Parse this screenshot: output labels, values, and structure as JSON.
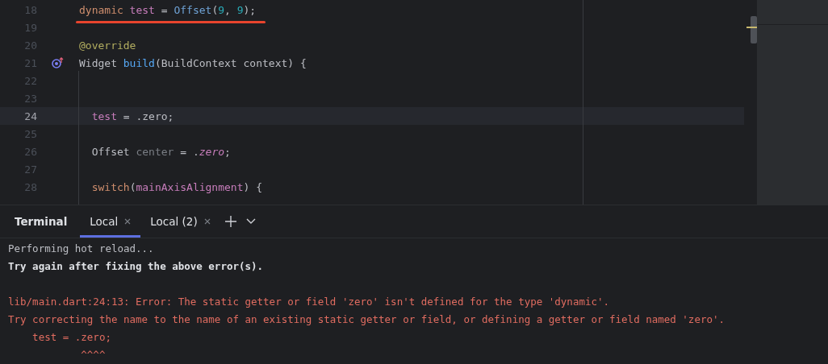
{
  "editor": {
    "lines": [
      {
        "number": "18",
        "current": false,
        "underlined": true,
        "tokens": [
          {
            "text": "dynamic",
            "kind": "keyword"
          },
          {
            "text": " test",
            "kind": "field"
          },
          {
            "text": " = ",
            "kind": "plain"
          },
          {
            "text": "Offset",
            "kind": "type"
          },
          {
            "text": "(",
            "kind": "plain"
          },
          {
            "text": "9",
            "kind": "number"
          },
          {
            "text": ", ",
            "kind": "plain"
          },
          {
            "text": "9",
            "kind": "number"
          },
          {
            "text": ");",
            "kind": "plain"
          }
        ]
      },
      {
        "number": "19",
        "current": false,
        "underlined": false
      },
      {
        "number": "20",
        "current": false,
        "underlined": false,
        "tokens": [
          {
            "text": "@override",
            "kind": "annotation"
          }
        ]
      },
      {
        "number": "21",
        "current": false,
        "underlined": false,
        "override_marker": true,
        "tokens": [
          {
            "text": "Widget ",
            "kind": "plain"
          },
          {
            "text": "build",
            "kind": "function"
          },
          {
            "text": "(BuildContext context) {",
            "kind": "plain"
          }
        ]
      },
      {
        "number": "22",
        "current": false,
        "underlined": false
      },
      {
        "number": "23",
        "current": false,
        "underlined": false
      },
      {
        "number": "24",
        "current": true,
        "underlined": false,
        "tokens": [
          {
            "text": "  test",
            "kind": "field"
          },
          {
            "text": " = .zero;",
            "kind": "plain"
          }
        ]
      },
      {
        "number": "25",
        "current": false,
        "underlined": false
      },
      {
        "number": "26",
        "current": false,
        "underlined": false,
        "tokens": [
          {
            "text": "  Offset ",
            "kind": "plain"
          },
          {
            "text": "center",
            "kind": "unused"
          },
          {
            "text": " = .",
            "kind": "plain"
          },
          {
            "text": "zero",
            "kind": "static"
          },
          {
            "text": ";",
            "kind": "plain"
          }
        ]
      },
      {
        "number": "27",
        "current": false,
        "underlined": false
      },
      {
        "number": "28",
        "current": false,
        "underlined": false,
        "tokens": [
          {
            "text": "  switch",
            "kind": "keyword"
          },
          {
            "text": "(",
            "kind": "plain"
          },
          {
            "text": "mainAxisAlignment",
            "kind": "field"
          },
          {
            "text": ") {",
            "kind": "plain"
          }
        ]
      }
    ]
  },
  "terminal": {
    "title": "Terminal",
    "tabs": [
      {
        "label": "Local",
        "selected": true
      },
      {
        "label": "Local (2)",
        "selected": false
      }
    ],
    "output_blocks": [
      {
        "lines": [
          {
            "text": "Performing hot reload...",
            "kind": "info"
          },
          {
            "text": "Try again after fixing the above error(s).",
            "kind": "bold"
          }
        ]
      },
      {
        "lines": [
          {
            "text": "lib/main.dart:24:13: Error: The static getter or field 'zero' isn't defined for the type 'dynamic'.",
            "kind": "error"
          },
          {
            "text": "Try correcting the name to the name of an existing static getter or field, or defining a getter or field named 'zero'.",
            "kind": "error"
          },
          {
            "text": "    test = .zero;",
            "kind": "error"
          },
          {
            "text": "            ^^^^",
            "kind": "error"
          }
        ]
      }
    ]
  }
}
